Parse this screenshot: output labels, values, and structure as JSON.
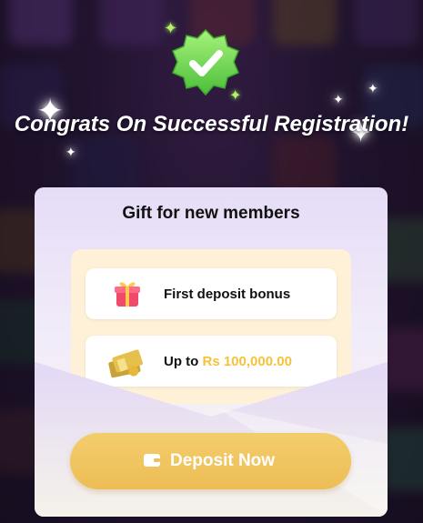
{
  "dialog": {
    "title": "Congrats On Successful Registration!",
    "card_title": "Gift for new members",
    "items": [
      {
        "icon": "gift-box-icon",
        "label": "First deposit bonus"
      },
      {
        "icon": "money-stack-icon",
        "prefix": "Up to",
        "amount": "Rs 100,000.00"
      }
    ],
    "deposit_button": {
      "icon": "wallet-icon",
      "label": "Deposit Now"
    }
  },
  "colors": {
    "accent": "#f0c45c",
    "amount": "#f5c23b",
    "check_green": "#7ed957",
    "card_top": "#e6dcf7",
    "card_bottom": "#f7f4ec"
  }
}
